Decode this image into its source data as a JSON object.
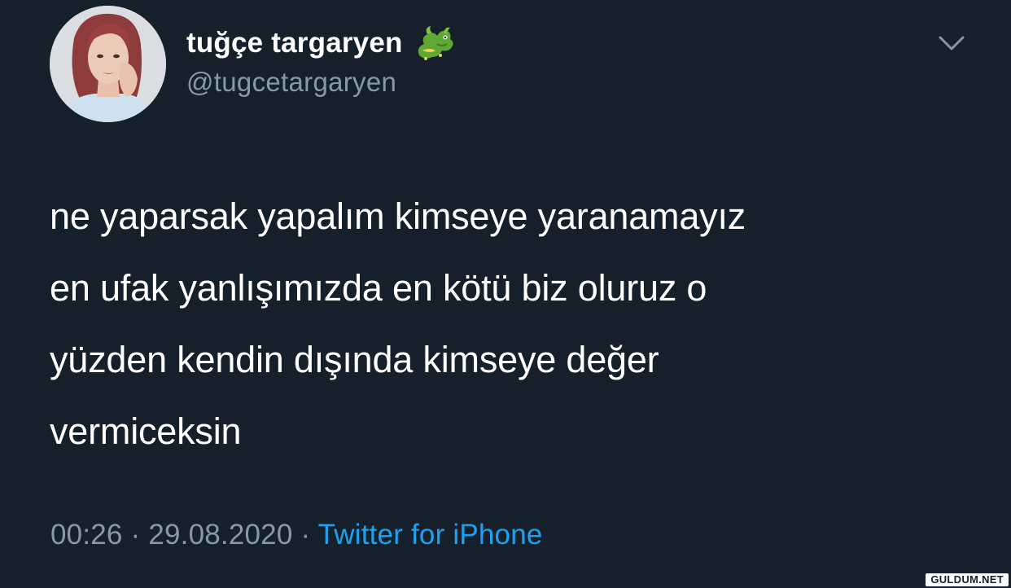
{
  "author": {
    "display_name": "tuğçe targaryen",
    "name_emoji": "dragon-icon",
    "handle": "@tugcetargaryen"
  },
  "tweet": {
    "text_lines": [
      "ne yaparsak yapalım kimseye yaranamayız",
      "en ufak yanlışımızda en kötü biz oluruz o",
      "yüzden kendin dışında kimseye değer",
      "vermiceksin"
    ]
  },
  "meta": {
    "time": "00:26",
    "separator": "·",
    "date": "29.08.2020",
    "source": "Twitter for iPhone"
  },
  "watermark": "GULDUM.NET",
  "colors": {
    "background": "#15202b",
    "text": "#ffffff",
    "secondary_text": "#8899a6",
    "link": "#1da1f2"
  }
}
